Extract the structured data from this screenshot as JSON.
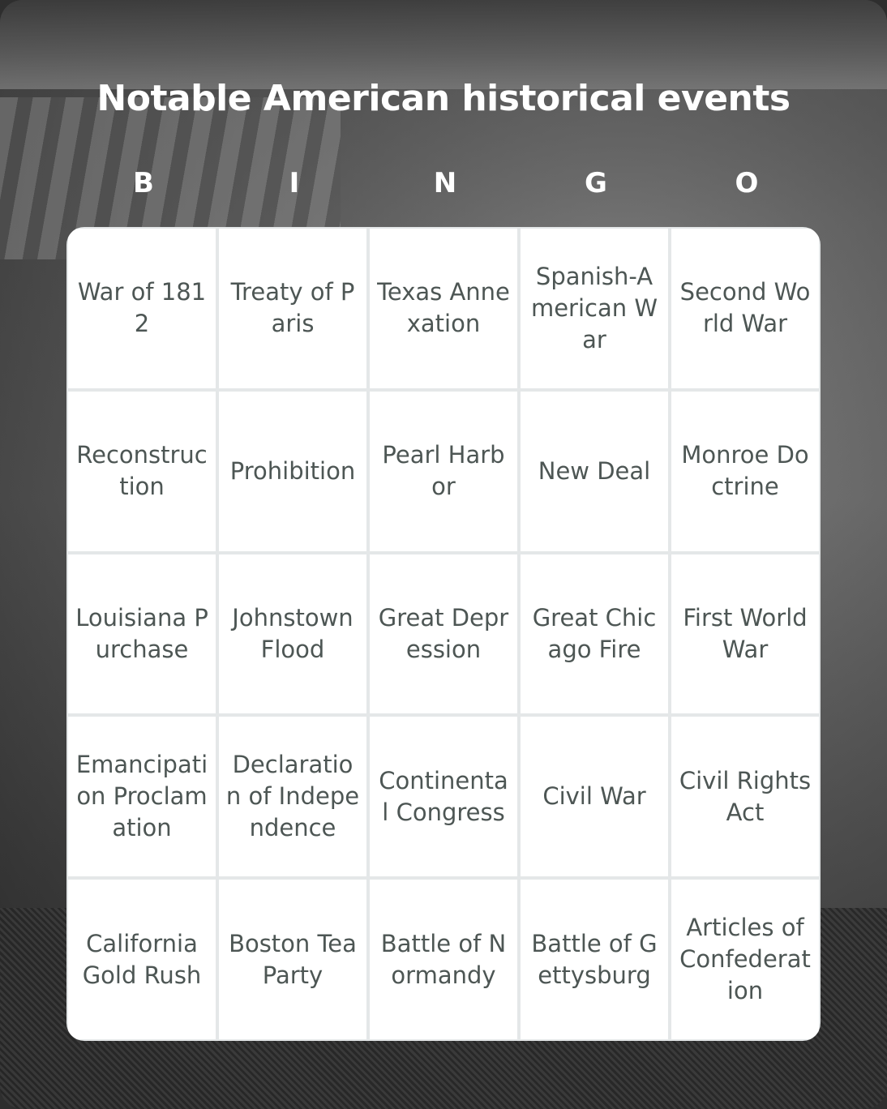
{
  "title": "Notable American historical events",
  "header_letters": [
    "B",
    "I",
    "N",
    "G",
    "O"
  ],
  "grid": [
    [
      "War of 1812",
      "Treaty of Paris",
      "Texas Annexation",
      "Spanish-American War",
      "Second World War"
    ],
    [
      "Reconstruction",
      "Prohibition",
      "Pearl Harbor",
      "New Deal",
      "Monroe Doctrine"
    ],
    [
      "Louisiana Purchase",
      "Johnstown Flood",
      "Great Depression",
      "Great Chicago Fire",
      "First World War"
    ],
    [
      "Emancipation Proclamation",
      "Declaration of Independence",
      "Continental Congress",
      "Civil War",
      "Civil Rights Act"
    ],
    [
      "California Gold Rush",
      "Boston Tea Party",
      "Battle of Normandy",
      "Battle of Gettysburg",
      "Articles of Confederation"
    ]
  ],
  "colors": {
    "cell_text": "#4d5654",
    "grid_line": "#e4e7e8",
    "title": "#ffffff"
  }
}
